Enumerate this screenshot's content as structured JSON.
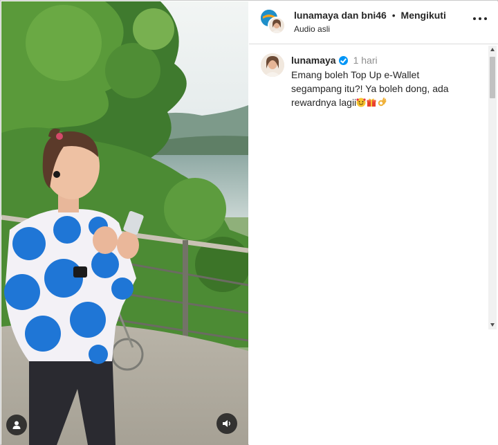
{
  "header": {
    "account_primary": "lunamaya",
    "joiner": "dan",
    "account_secondary": "bni46",
    "separator": "•",
    "follow_status": "Mengikuti",
    "audio_label": "Audio asli",
    "more_icon": "more-horizontal-icon"
  },
  "caption": {
    "username": "lunamaya",
    "verified": true,
    "time": "1 hari",
    "text": "Emang boleh Top Up e-Wallet segampang itu?! Ya boleh dong, ada rewardnya lagii",
    "emojis": [
      "smiling-face-with-hearts",
      "gift",
      "ok-hand"
    ]
  },
  "media": {
    "type": "video",
    "icons": [
      "user-profile-icon",
      "speaker-icon"
    ]
  },
  "colors": {
    "verified": "#0095f6",
    "text": "#262626",
    "muted": "#8e8e8e",
    "divider": "#dbdbdb"
  }
}
